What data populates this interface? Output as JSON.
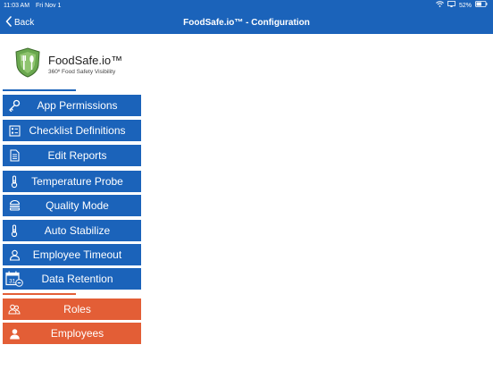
{
  "status_bar": {
    "time": "11:03 AM",
    "date": "Fri Nov 1",
    "battery": "52%",
    "icons": [
      "wifi-icon",
      "screen-mirror-icon",
      "battery-icon"
    ]
  },
  "nav": {
    "back_label": "Back",
    "title": "FoodSafe.io™ - Configuration"
  },
  "brand": {
    "name": "FoodSafe.io™",
    "tagline": "360º Food Safety Visibility"
  },
  "menu": {
    "config_items": [
      {
        "label": "App Permissions",
        "icon": "key-icon"
      },
      {
        "label": "Checklist Definitions",
        "icon": "checklist-icon"
      },
      {
        "label": "Edit Reports",
        "icon": "document-icon"
      },
      {
        "label": "Temperature Probe",
        "icon": "thermometer-icon"
      },
      {
        "label": "Quality Mode",
        "icon": "burger-icon"
      },
      {
        "label": "Auto Stabilize",
        "icon": "thermometer-icon"
      },
      {
        "label": "Employee Timeout",
        "icon": "user-outline-icon"
      },
      {
        "label": "Data Retention",
        "icon": "calendar-icon",
        "icon_text": "31"
      }
    ],
    "people_items": [
      {
        "label": "Roles",
        "icon": "group-icon"
      },
      {
        "label": "Employees",
        "icon": "user-icon"
      }
    ]
  },
  "colors": {
    "primary_blue": "#1b63ba",
    "accent_orange": "#e35e36",
    "logo_green": "#6aa84f"
  }
}
